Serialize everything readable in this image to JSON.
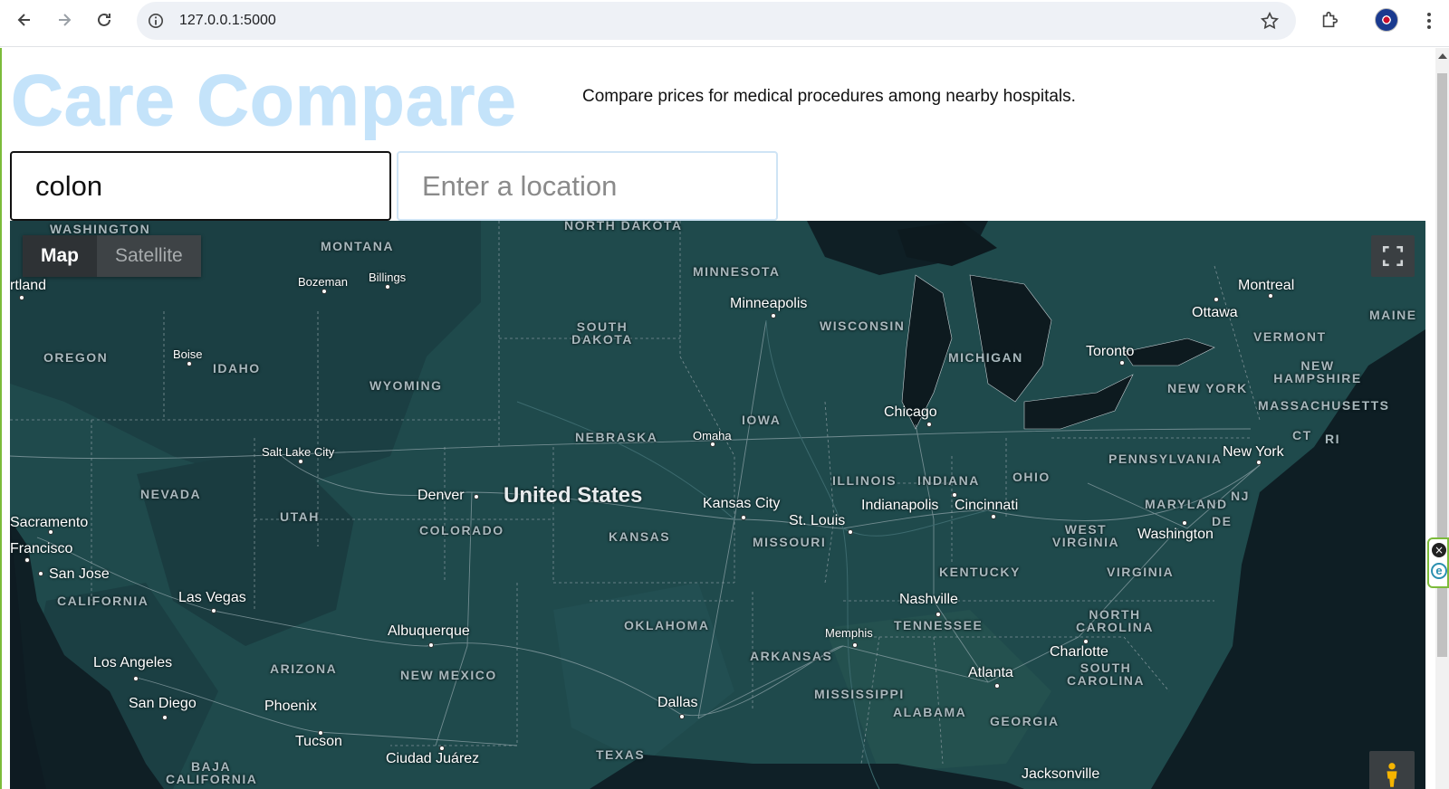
{
  "browser": {
    "url": "127.0.0.1:5000"
  },
  "page": {
    "title": "Care Compare",
    "tagline": "Compare prices for medical procedures among nearby hospitals.",
    "search": {
      "value": "colon"
    },
    "location": {
      "value": "",
      "placeholder": "Enter a location"
    }
  },
  "map": {
    "type_control": {
      "map_label": "Map",
      "satellite_label": "Satellite",
      "selected": "Map"
    },
    "country": "United States",
    "states": [
      "WASHINGTON",
      "MONTANA",
      "NORTH DAKOTA",
      "MINNESOTA",
      "SOUTH DAKOTA",
      "WISCONSIN",
      "MICHIGAN",
      "OREGON",
      "IDAHO",
      "WYOMING",
      "IOWA",
      "NEBRASKA",
      "NEVADA",
      "UTAH",
      "COLORADO",
      "KANSAS",
      "MISSOURI",
      "ILLINOIS",
      "INDIANA",
      "OHIO",
      "PENNSYLVANIA",
      "NEW YORK",
      "VERMONT",
      "NEW HAMPSHIRE",
      "MASSACHUSETTS",
      "CT",
      "RI",
      "NJ",
      "MARYLAND",
      "DE",
      "WEST VIRGINIA",
      "VIRGINIA",
      "KENTUCKY",
      "TENNESSEE",
      "NORTH CAROLINA",
      "SOUTH CAROLINA",
      "CALIFORNIA",
      "ARIZONA",
      "NEW MEXICO",
      "OKLAHOMA",
      "ARKANSAS",
      "MISSISSIPPI",
      "ALABAMA",
      "GEORGIA",
      "TEXAS",
      "BAJA CALIFORNIA",
      "MAINE"
    ],
    "cities": [
      "rtland",
      "Bozeman",
      "Billings",
      "Minneapolis",
      "Montreal",
      "Ottawa",
      "Boise",
      "Toronto",
      "Chicago",
      "Omaha",
      "Salt Lake City",
      "New York",
      "Denver",
      "Kansas City",
      "Indianapolis",
      "Cincinnati",
      "Sacramento",
      "St. Louis",
      "Washington",
      "Francisco",
      "San Jose",
      "Las Vegas",
      "Nashville",
      "Albuquerque",
      "Memphis",
      "Charlotte",
      "Los Angeles",
      "Atlanta",
      "San Diego",
      "Phoenix",
      "Dallas",
      "Tucson",
      "Ciudad Juárez",
      "Jacksonville"
    ]
  }
}
